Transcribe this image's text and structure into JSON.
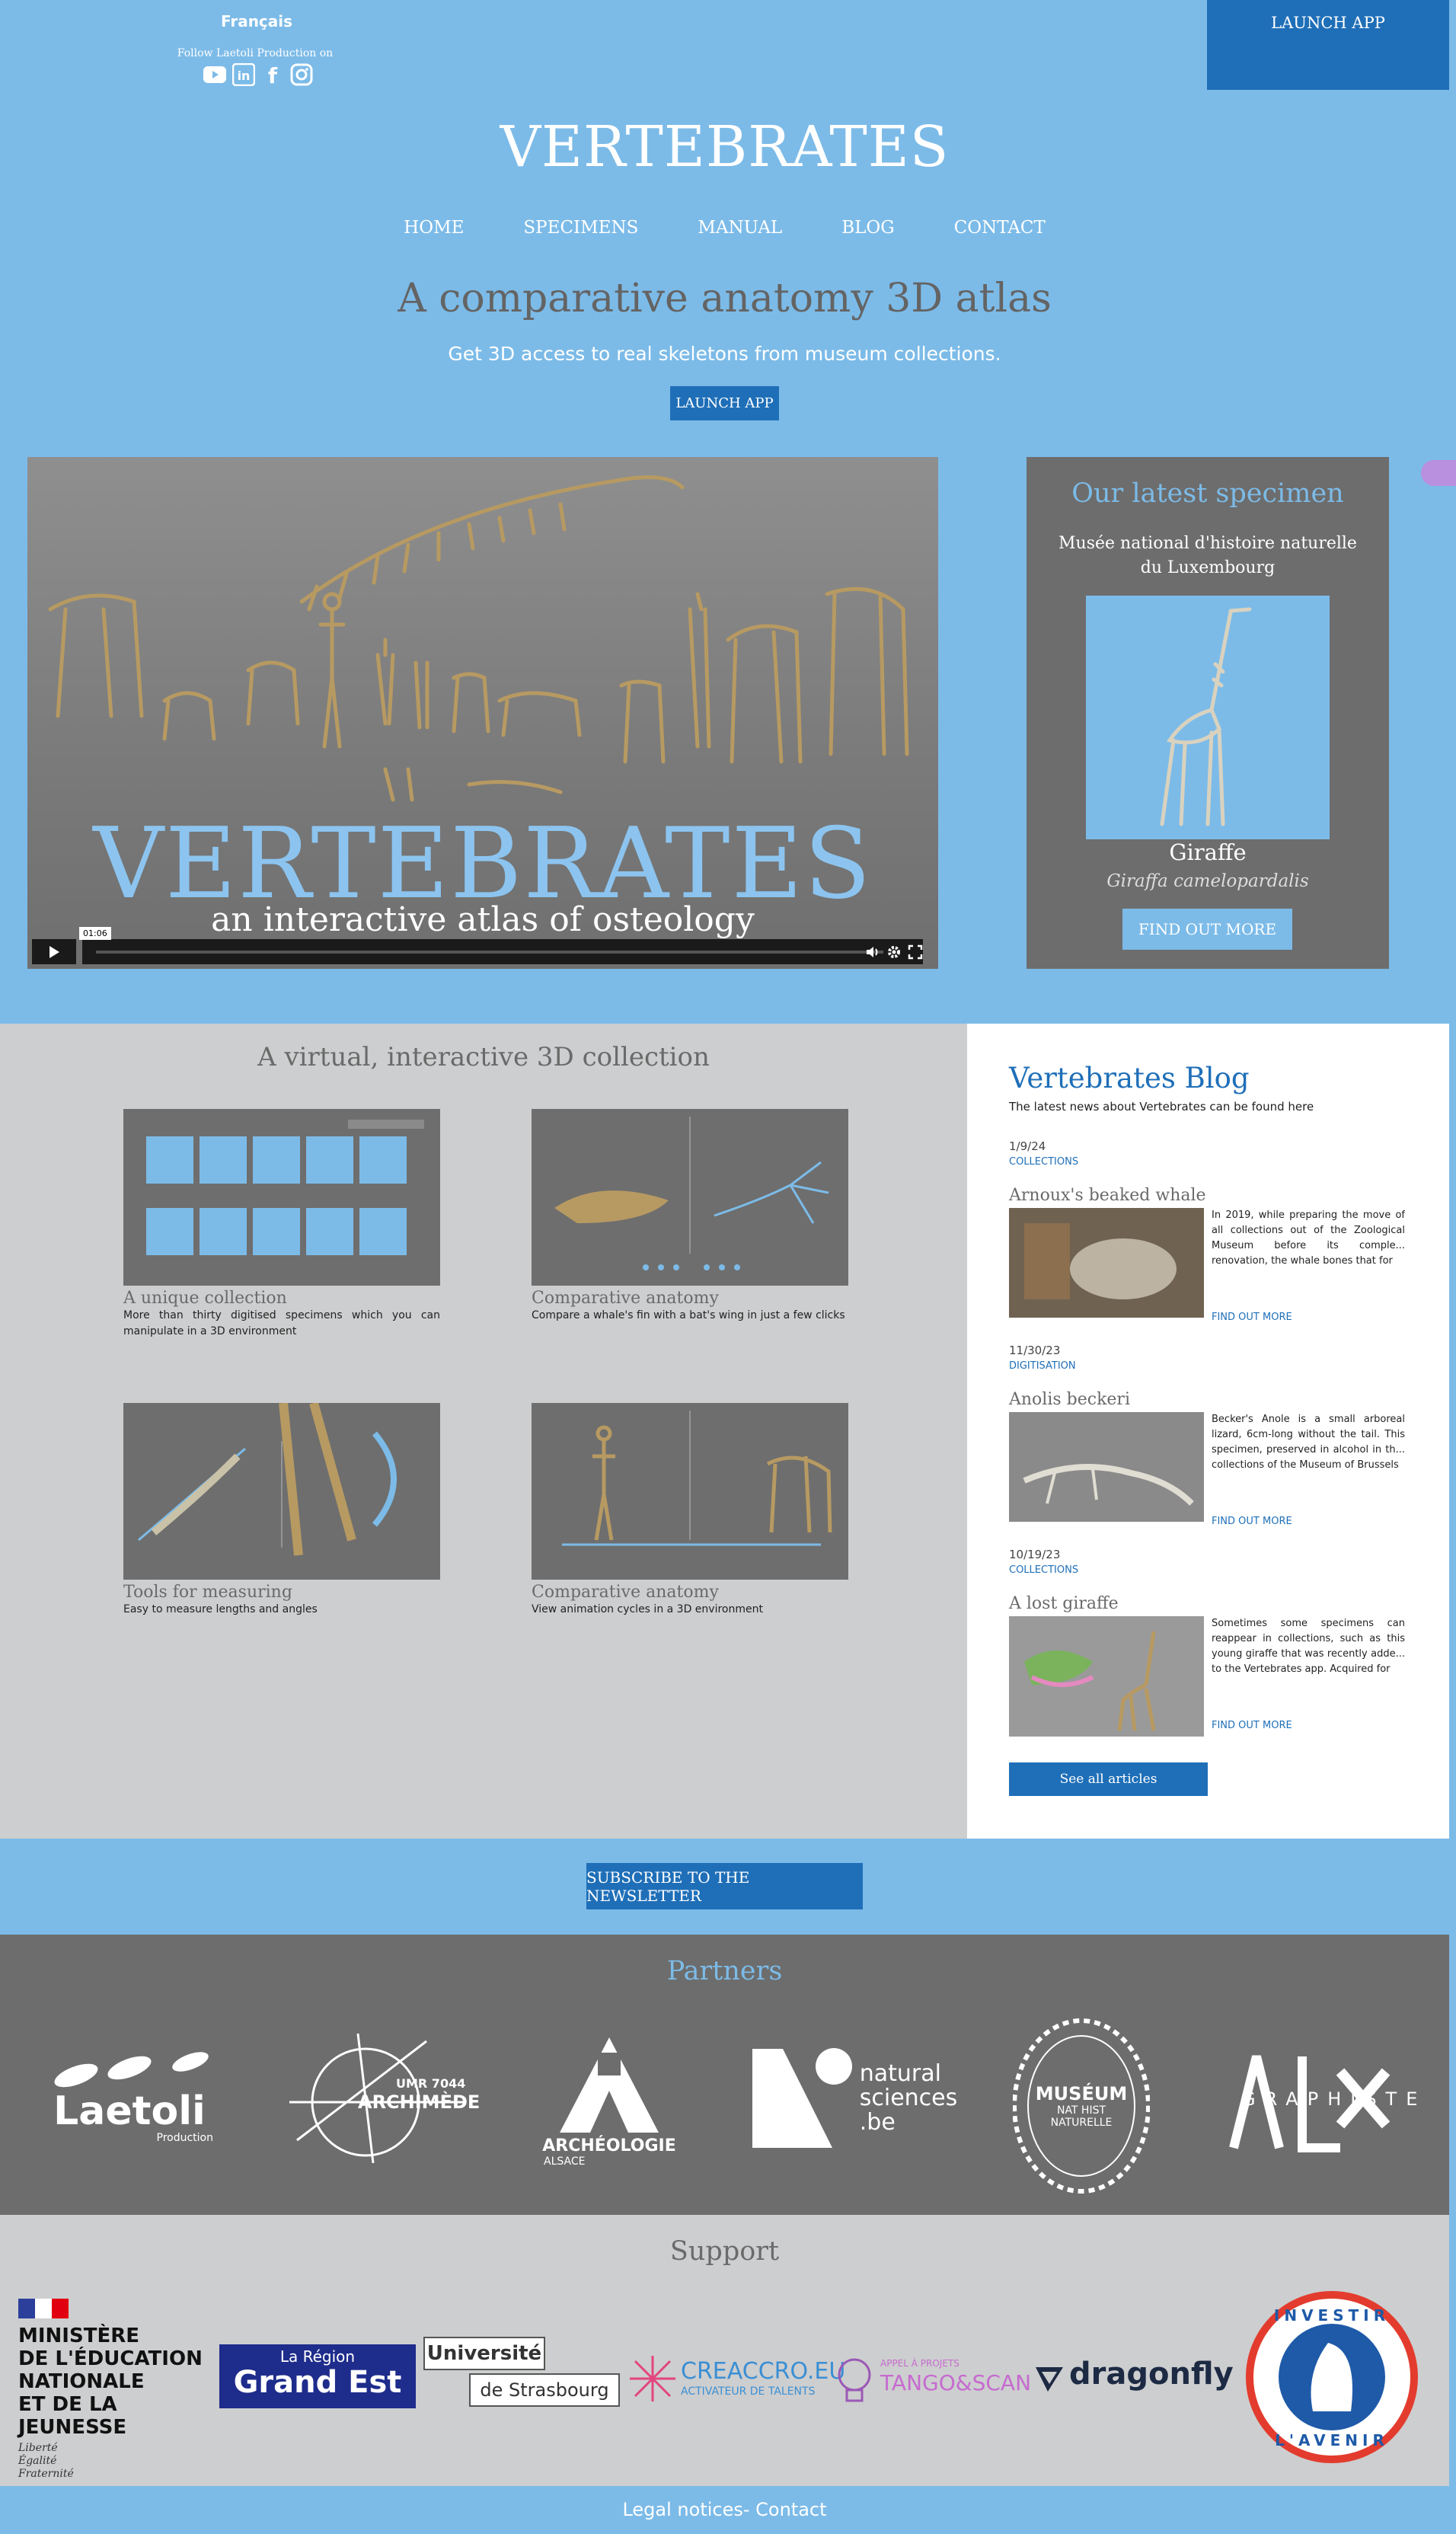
{
  "header": {
    "language": "Français",
    "follow_text": "Follow Laetoli Production on",
    "social": [
      "youtube-icon",
      "linkedin-icon",
      "facebook-icon",
      "instagram-icon"
    ],
    "launch_app_top": "LAUNCH APP",
    "site_title": "VERTEBRATES",
    "nav": [
      "HOME",
      "SPECIMENS",
      "MANUAL",
      "BLOG",
      "CONTACT"
    ],
    "tagline": "A comparative anatomy 3D atlas",
    "subtagline": "Get 3D access to real skeletons from museum collections.",
    "launch_app_mid": "LAUNCH APP"
  },
  "video": {
    "title": "VERTEBRATES",
    "subtitle": "an interactive atlas of osteology",
    "time": "01:06"
  },
  "latest": {
    "heading": "Our latest specimen",
    "museum": "Musée national d'histoire naturelle du Luxembourg",
    "name": "Giraffe",
    "latin": "Giraffa camelopardalis",
    "button": "FIND OUT MORE"
  },
  "features": {
    "heading": "A virtual, interactive 3D collection",
    "items": [
      {
        "title": "A unique collection",
        "desc": "More than thirty digitised specimens which you can manipulate in a 3D environment"
      },
      {
        "title": "Comparative anatomy",
        "desc": "Compare a whale's fin with a bat's wing in just a few clicks"
      },
      {
        "title": "Tools for measuring",
        "desc": "Easy to measure lengths and angles"
      },
      {
        "title": "Comparative anatomy",
        "desc": "View animation cycles in a 3D environment"
      }
    ]
  },
  "blog": {
    "heading": "Vertebrates Blog",
    "subheading": "The latest news about Vertebrates can be found here",
    "posts": [
      {
        "date": "1/9/24",
        "category": "COLLECTIONS",
        "title": "Arnoux's beaked whale",
        "excerpt": "In 2019, while preparing the move of all collections out of the Zoological Museum before its comple... renovation, the whale bones that for",
        "more": "FIND OUT MORE"
      },
      {
        "date": "11/30/23",
        "category": "DIGITISATION",
        "title": "Anolis beckeri",
        "excerpt": "Becker's Anole is a small arboreal lizard, 6cm-long without the tail. This specimen, preserved in alcohol in th... collections of the Museum of Brussels",
        "more": "FIND OUT MORE"
      },
      {
        "date": "10/19/23",
        "category": "COLLECTIONS",
        "title": "A lost giraffe",
        "excerpt": "Sometimes some specimens can reappear in collections, such as this young giraffe that was recently adde... to the Vertebrates app. Acquired for",
        "more": "FIND OUT MORE"
      }
    ],
    "see_all": "See all articles"
  },
  "subscribe": "SUBSCRIBE TO THE NEWSLETTER",
  "partners": {
    "heading": "Partners",
    "logos": [
      {
        "name": "Laetoli",
        "sub": "Production"
      },
      {
        "name": "ARCHIMÈDE",
        "sub": "UMR 7044"
      },
      {
        "name": "ARCHÉOLOGIE",
        "sub": "ALSACE"
      },
      {
        "name": "natural",
        "sub": "sciences",
        ".be": ".be"
      },
      {
        "name": "MUSÉUM",
        "sub": "NAT HIST NATURELLE"
      },
      {
        "name": "GRAPHISTE"
      }
    ]
  },
  "support": {
    "heading": "Support",
    "ministere": [
      "MINISTÈRE",
      "DE L'ÉDUCATION",
      "NATIONALE",
      "ET DE LA JEUNESSE"
    ],
    "devise": [
      "Liberté",
      "Égalité",
      "Fraternité"
    ],
    "region_top": "La Région",
    "region_main": "Grand Est",
    "univ_top": "Université",
    "univ_bottom": "de Strasbourg",
    "creaccro": "CREACCRO.EU",
    "creaccro_sub": "ACTIVATEUR DE TALENTS",
    "tango_top": "APPEL À PROJETS",
    "tango": "TANGO&SCAN",
    "dragonfly": "dragonfly",
    "investir_top": "INVESTIR",
    "investir_bottom": "L'AVENIR"
  },
  "footer": "Legal notices- Contact",
  "colors": {
    "sky": "#7cbbe8",
    "accent": "#1f6fb8",
    "grey": "#6d6d6d",
    "light": "#cdcecf"
  }
}
